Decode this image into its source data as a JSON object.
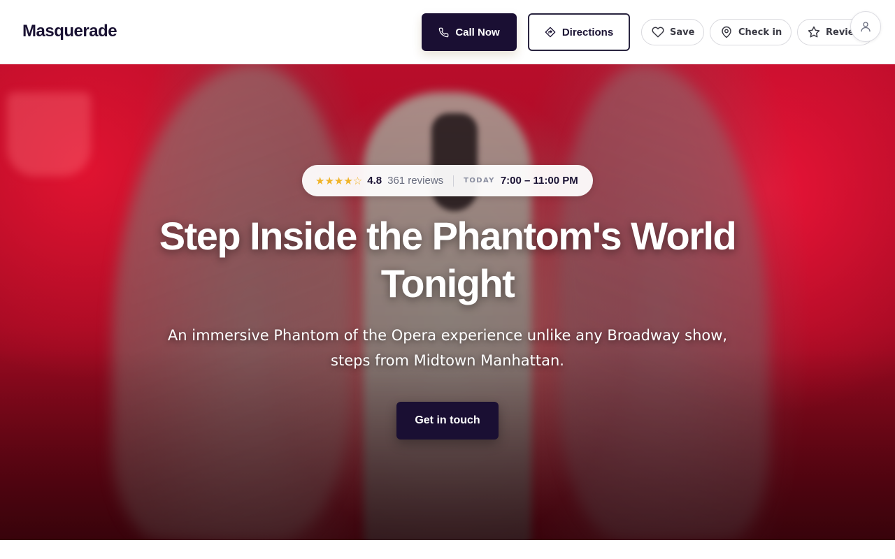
{
  "header": {
    "brand": "Masquerade",
    "call_label": "Call Now",
    "directions_label": "Directions",
    "save_label": "Save",
    "checkin_label": "Check in",
    "review_label": "Review"
  },
  "hero": {
    "stars_display": "★★★★☆",
    "rating": "4.8",
    "reviews": "361 reviews",
    "today_label": "TODAY",
    "hours": "7:00 – 11:00 PM",
    "headline": "Step Inside the Phantom's World Tonight",
    "subhead": "An immersive Phantom of the Opera experience unlike any Broadway show, steps from Midtown Manhattan.",
    "cta_label": "Get in touch"
  },
  "icons": {
    "call": "phone-icon",
    "directions": "directions-icon",
    "save": "heart-icon",
    "checkin": "map-pin-icon",
    "review": "star-icon",
    "account": "user-icon"
  },
  "colors": {
    "brand_dark": "#1a0f33",
    "star": "#f0b429",
    "hero_red": "#b80d2a"
  }
}
